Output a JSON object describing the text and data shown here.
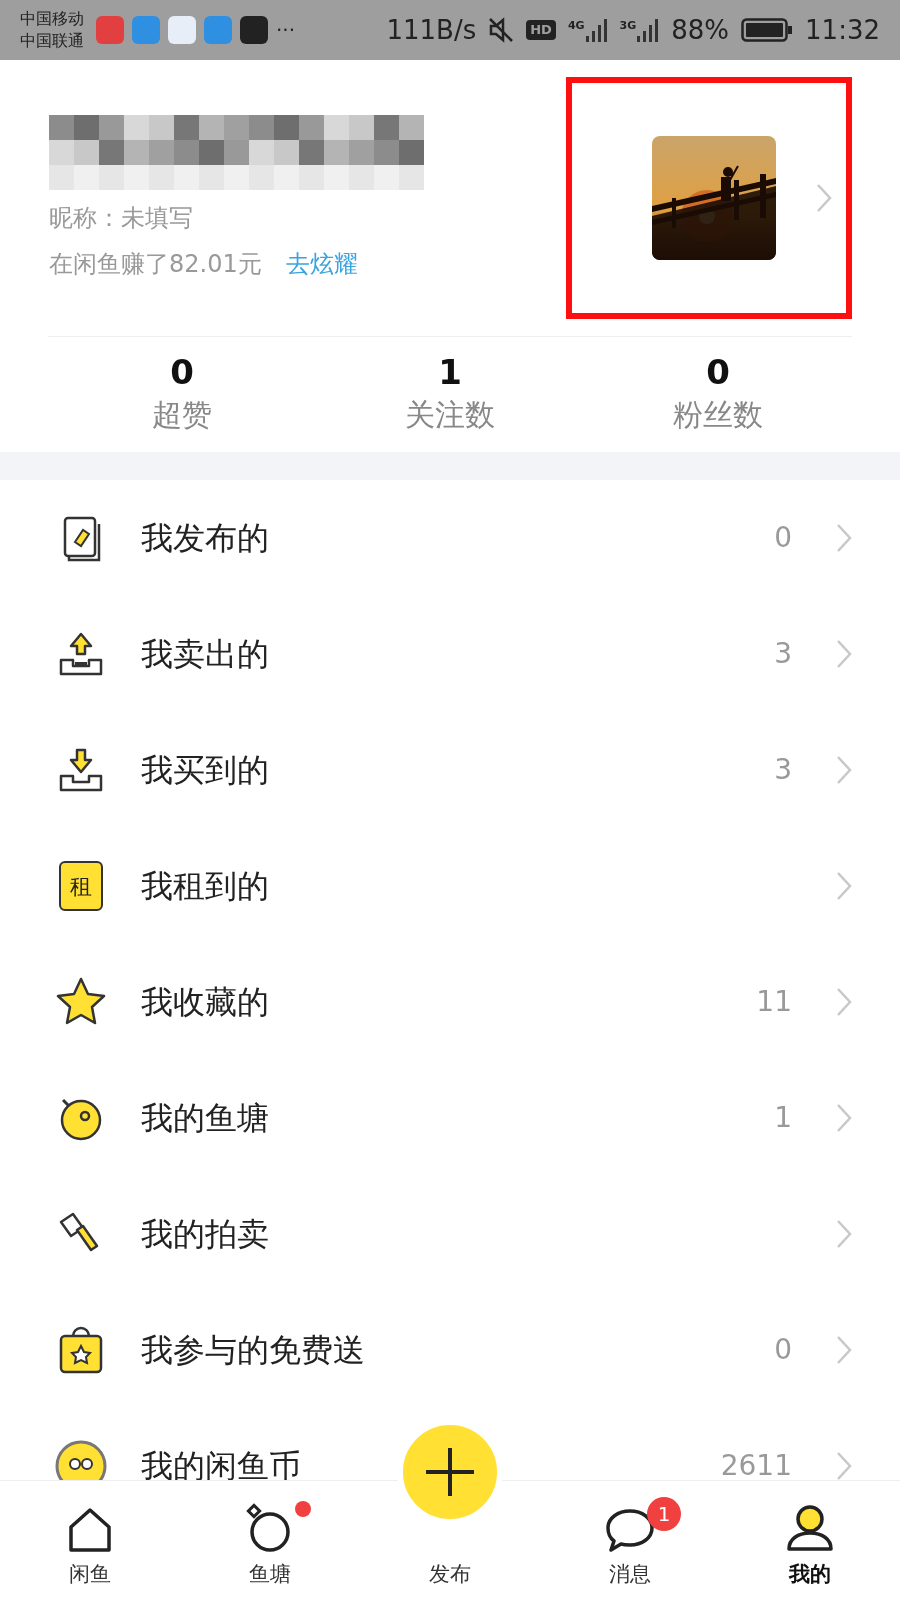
{
  "status_bar": {
    "carriers": [
      "中国移动",
      "中国联通"
    ],
    "more": "···",
    "speed": "111B/s",
    "hd": "HD",
    "networks": [
      {
        "label": "4G"
      },
      {
        "label": "3G"
      }
    ],
    "battery": "88%",
    "time": "11:32"
  },
  "profile": {
    "nickname": "昵称：未填写",
    "earnings": "在闲鱼赚了82.01元",
    "share_link": "去炫耀",
    "highlighted": true
  },
  "stats": [
    {
      "value": "0",
      "label": "超赞"
    },
    {
      "value": "1",
      "label": "关注数"
    },
    {
      "value": "0",
      "label": "粉丝数"
    }
  ],
  "menu": [
    {
      "label": "我发布的",
      "count": "0"
    },
    {
      "label": "我卖出的",
      "count": "3"
    },
    {
      "label": "我买到的",
      "count": "3"
    },
    {
      "label": "我租到的",
      "icon_text": "租"
    },
    {
      "label": "我收藏的",
      "count": "11"
    },
    {
      "label": "我的鱼塘",
      "count": "1"
    },
    {
      "label": "我的拍卖"
    },
    {
      "label": "我参与的免费送",
      "count": "0"
    },
    {
      "label": "我的闲鱼币",
      "count": "2611"
    }
  ],
  "nav": [
    {
      "label": "闲鱼",
      "selected": false
    },
    {
      "label": "鱼塘",
      "selected": false,
      "dot": true
    },
    {
      "label": "发布",
      "selected": false,
      "kind": "publish"
    },
    {
      "label": "消息",
      "selected": false,
      "badge": "1"
    },
    {
      "label": "我的",
      "selected": true
    }
  ]
}
